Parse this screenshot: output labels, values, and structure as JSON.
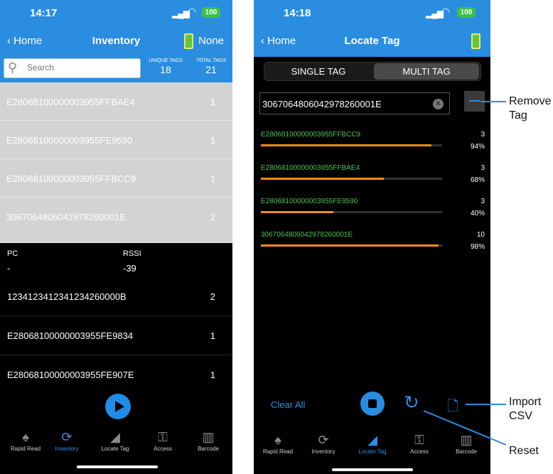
{
  "left": {
    "status": {
      "time": "14:17",
      "battery": "100"
    },
    "nav": {
      "back": "Home",
      "title": "Inventory",
      "right": "None"
    },
    "search": {
      "placeholder": "Search"
    },
    "unique": {
      "label": "UNIQUE TAGS",
      "value": "18"
    },
    "total": {
      "label": "TOTAL TAGS",
      "value": "21"
    },
    "gray_rows": [
      {
        "epc": "E28068100000003955FFBAE4",
        "count": "1"
      },
      {
        "epc": "E28068100000003955FE9590",
        "count": "1"
      },
      {
        "epc": "E28068100000003955FFBCC9",
        "count": "1"
      },
      {
        "epc": "3067064806042978260001E",
        "count": "2"
      }
    ],
    "pc_label": "PC",
    "pc_value": "-",
    "rssi_label": "RSSI",
    "rssi_value": "-39",
    "black_rows": [
      {
        "epc": "1234123412341234260000B",
        "count": "2"
      },
      {
        "epc": "E28068100000003955FE9834",
        "count": "1"
      },
      {
        "epc": "E28068100000003955FE907E",
        "count": "1"
      }
    ],
    "tabs": [
      "Rapid Read",
      "Inventory",
      "Locate Tag",
      "Access",
      "Barcode"
    ]
  },
  "right": {
    "status": {
      "time": "14:18",
      "battery": "100"
    },
    "nav": {
      "back": "Home",
      "title": "Locate Tag"
    },
    "seg": {
      "single": "SINGLE TAG",
      "multi": "MULTI TAG"
    },
    "tag_input": "3067064806042978260001E",
    "locate_rows": [
      {
        "epc": "E28068100000003955FFBCC9",
        "count": "3",
        "percent": "94%",
        "level": 0.94
      },
      {
        "epc": "E28068100000003955FFBAE4",
        "count": "3",
        "percent": "68%",
        "level": 0.68
      },
      {
        "epc": "E28068100000003955FE9590",
        "count": "3",
        "percent": "40%",
        "level": 0.4
      },
      {
        "epc": "3067064806042978260001E",
        "count": "10",
        "percent": "98%",
        "level": 0.98
      }
    ],
    "clear_all": "Clear All",
    "tabs": [
      "Rapid Read",
      "Inventory",
      "Locate Tag",
      "Access",
      "Barcode"
    ]
  },
  "annotations": {
    "remove": "Remove",
    "remove2": "Tag",
    "import": "Import",
    "import2": "CSV",
    "reset": "Reset"
  },
  "colors": {
    "accent": "#2a8de0",
    "bar": "#f08c1a",
    "epc_green": "#4ec24e"
  }
}
